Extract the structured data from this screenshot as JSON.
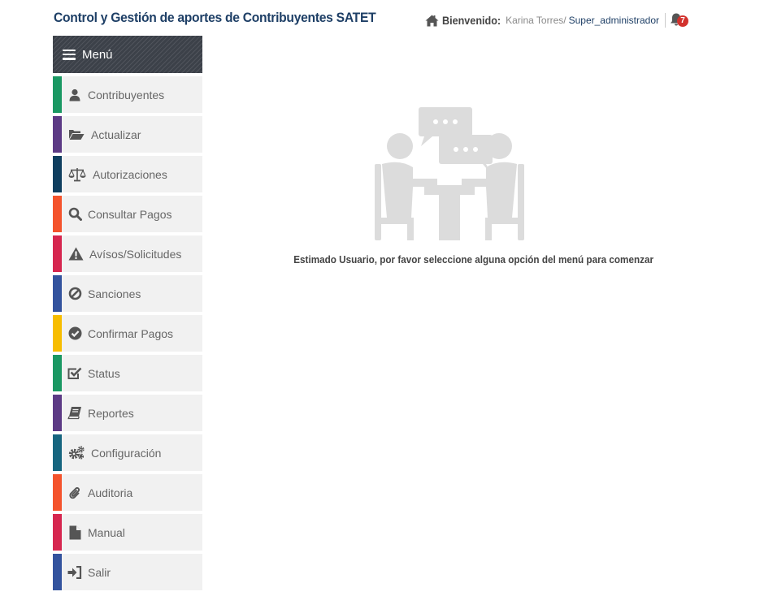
{
  "header": {
    "title": "Control y Gestión de aportes de Contribuyentes SATET",
    "welcome_label": "Bienvenido:",
    "user_name": "Karina Torres/",
    "user_role": "Super_administrador",
    "notification_count": "7"
  },
  "sidebar": {
    "menu_label": "Menú",
    "items": [
      {
        "label": "Contribuyentes",
        "icon": "user-icon",
        "color": "#1a9863"
      },
      {
        "label": "Actualizar",
        "icon": "folder-open-icon",
        "color": "#5c3a85"
      },
      {
        "label": "Autorizaciones",
        "icon": "balance-scale-icon",
        "color": "#0f3e5f"
      },
      {
        "label": "Consultar Pagos",
        "icon": "search-icon",
        "color": "#f4532c"
      },
      {
        "label": "Avísos/Solicitudes",
        "icon": "warning-icon",
        "color": "#d6264f"
      },
      {
        "label": "Sanciones",
        "icon": "ban-icon",
        "color": "#33539e"
      },
      {
        "label": "Confirmar Pagos",
        "icon": "check-circle-icon",
        "color": "#f7bd00"
      },
      {
        "label": "Status",
        "icon": "check-square-icon",
        "color": "#1a9863"
      },
      {
        "label": "Reportes",
        "icon": "book-icon",
        "color": "#5c3a85"
      },
      {
        "label": "Configuración",
        "icon": "gears-icon",
        "color": "#16657f"
      },
      {
        "label": "Auditoria",
        "icon": "paperclip-icon",
        "color": "#f4532c"
      },
      {
        "label": "Manual",
        "icon": "file-icon",
        "color": "#d6264f"
      },
      {
        "label": "Salir",
        "icon": "sign-in-icon",
        "color": "#33539e"
      }
    ]
  },
  "main": {
    "message": "Estimado Usuario, por favor seleccione alguna opción del menú para comenzar"
  }
}
